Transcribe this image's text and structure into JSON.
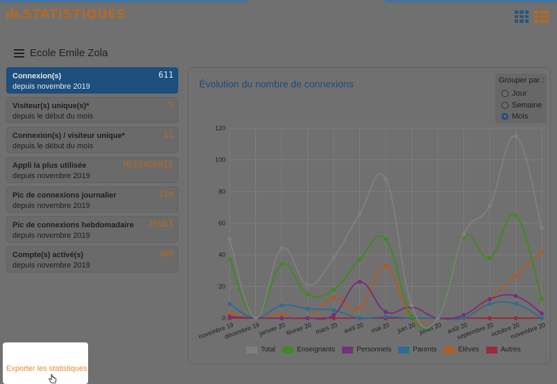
{
  "app": {
    "title": "STATISTIQUES",
    "icon": "bar-chart-icon"
  },
  "school": {
    "name": "Ecole Emile Zola"
  },
  "cards": [
    {
      "title": "Connexion(s)",
      "subtitle": "depuis novembre 2019",
      "value": "611",
      "active": true
    },
    {
      "title": "Visiteur(s) unique(s)*",
      "subtitle": "depuis le début du mois",
      "value": "5"
    },
    {
      "title": "Connexion(s) / visiteur unique*",
      "subtitle": "depuis le début du mois",
      "value": "11"
    },
    {
      "title": "Appli la plus utilisée",
      "subtitle": "depuis novembre 2019",
      "value": "MESSAGERIE"
    },
    {
      "title": "Pic de connexions journalier",
      "subtitle": "depuis novembre 2019",
      "value": "11H"
    },
    {
      "title": "Pic de connexions hebdomadaire",
      "subtitle": "depuis novembre 2019",
      "value": "JEUDI"
    },
    {
      "title": "Compte(s) activé(s)",
      "subtitle": "depuis novembre 2019",
      "value": "308"
    }
  ],
  "export": {
    "label": "Exporter les statistiques"
  },
  "group_by": {
    "title": "Grouper par :",
    "options": [
      {
        "label": "Jour",
        "checked": false
      },
      {
        "label": "Semaine",
        "checked": false
      },
      {
        "label": "Mois",
        "checked": true
      }
    ]
  },
  "chart_data": {
    "type": "line",
    "title": "Évolution du nombre de connexions",
    "categories": [
      "novembre 19",
      "décembre 19",
      "janvier 20",
      "février 20",
      "mars 20",
      "avril 20",
      "mai 20",
      "juin 20",
      "juillet 20",
      "août 20",
      "septembre 20",
      "octobre 20",
      "novembre 20"
    ],
    "ylim": [
      0,
      120
    ],
    "yticks": [
      0,
      20,
      40,
      60,
      80,
      100,
      120
    ],
    "grid": true,
    "legend_position": "bottom",
    "series": [
      {
        "name": "Total",
        "color": "#7f7f7f",
        "values": [
          50,
          0,
          44,
          21,
          38,
          66,
          88,
          8,
          0,
          53,
          71,
          115,
          57
        ]
      },
      {
        "name": "Enseignants",
        "color": "#3f8a1e",
        "values": [
          37,
          0,
          34,
          15,
          18,
          37,
          50,
          1,
          0,
          51,
          38,
          65,
          12
        ]
      },
      {
        "name": "Personnels",
        "color": "#73317a",
        "values": [
          1,
          0,
          0,
          0,
          2,
          23,
          4,
          7,
          0,
          2,
          12,
          14,
          3
        ]
      },
      {
        "name": "Parents",
        "color": "#2d6d92",
        "values": [
          9,
          0,
          8,
          6,
          5,
          0,
          1,
          0,
          0,
          0,
          9,
          9,
          0
        ]
      },
      {
        "name": "Élèves",
        "color": "#b05c22",
        "values": [
          3,
          0,
          2,
          0,
          13,
          6,
          33,
          0,
          0,
          0,
          12,
          27,
          42
        ]
      },
      {
        "name": "Autres",
        "color": "#9a2a3a",
        "values": [
          0,
          0,
          0,
          0,
          0,
          0,
          0,
          0,
          0,
          0,
          0,
          0,
          0
        ]
      }
    ]
  }
}
